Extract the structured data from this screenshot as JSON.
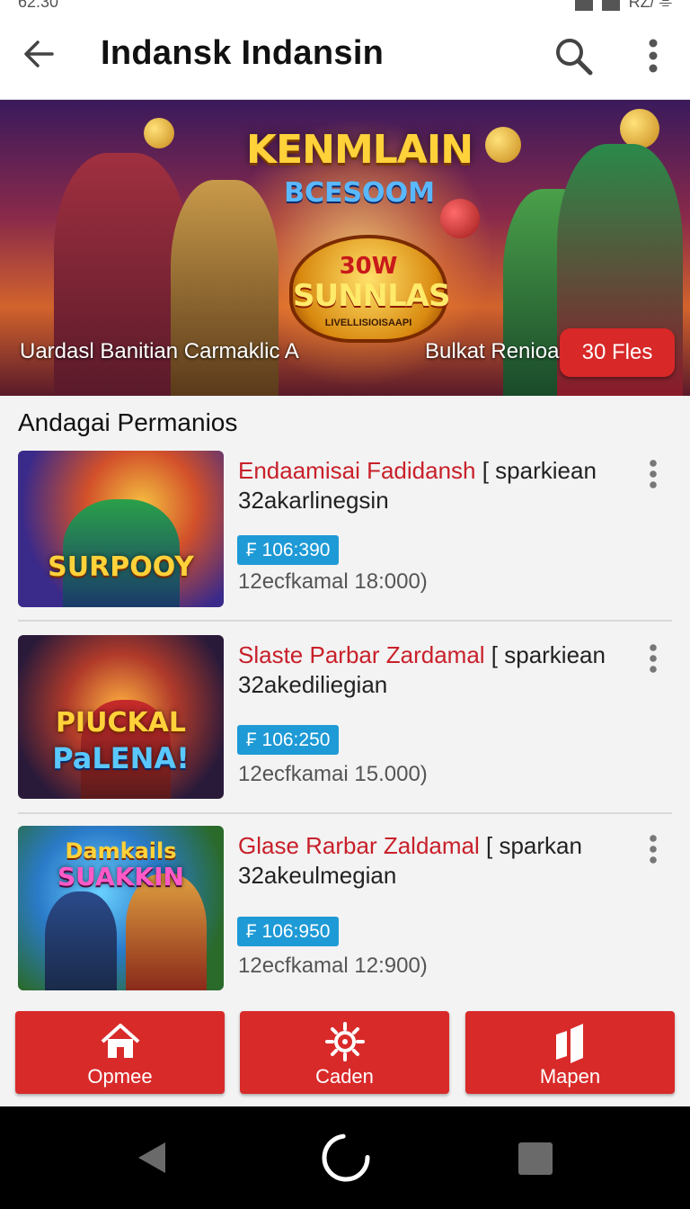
{
  "status_bar": {
    "time": "62:30",
    "right_text": "RZ/ ⌯"
  },
  "app_bar": {
    "title": "Indansk Indansin"
  },
  "hero": {
    "logo_title": "KENMLAIN",
    "logo_sub": "BCESOOM",
    "badge_top": "30W",
    "badge_main": "SUNNLAS",
    "badge_small": "LIVELLISIOISAAPI",
    "caption_left": "Uardasl Banitian Carmaklic A",
    "caption_right": "Bulkat Renioa",
    "cta": "30 Fles"
  },
  "section": {
    "title": "Andagai Permanios"
  },
  "items": [
    {
      "title_red": "Endaamisai Fadidansh",
      "title_rest": " [ sparkiean 32akarlinegsin",
      "price": "₣ 106:390",
      "meta": "12ecfkamal 18:000)",
      "thumb_text": "SURPOOY",
      "thumb_text2": ""
    },
    {
      "title_red": "Slaste Parbar Zardamal",
      "title_rest": " [ sparkiean 32akediliegian",
      "price": "₣ 106:250",
      "meta": "12ecfkamai 15.000)",
      "thumb_text": "PIUCKAL",
      "thumb_text2": "PaLENA!"
    },
    {
      "title_red": "Glase Rarbar Zaldamal",
      "title_rest": " [ sparkan 32akeulmegian",
      "price": "₣ 106:950",
      "meta": "12ecfkamal 12:900)",
      "thumb_text": "Damkails",
      "thumb_text2": "SUAKKIN"
    }
  ],
  "bottom_nav": [
    {
      "label": "Opmee",
      "icon": "home-icon"
    },
    {
      "label": "Caden",
      "icon": "gear-icon"
    },
    {
      "label": "Mapen",
      "icon": "map-icon"
    }
  ],
  "colors": {
    "accent_red": "#d92a2a",
    "price_blue": "#1e9ad6",
    "title_red": "#c8202a"
  }
}
